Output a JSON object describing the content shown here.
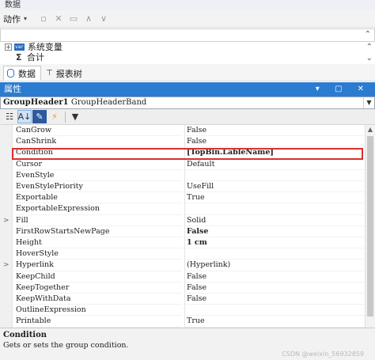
{
  "window": {
    "title": "数据"
  },
  "toolbar": {
    "actions_label": "动作"
  },
  "tree": {
    "items": [
      {
        "label": "系统变量",
        "icon": "var-icon"
      },
      {
        "label": "合计",
        "icon": "sigma-icon"
      }
    ]
  },
  "tabs": [
    {
      "label": "数据",
      "active": true
    },
    {
      "label": "报表树",
      "active": false
    }
  ],
  "properties_panel": {
    "title": "属性",
    "selected_object_name": "GroupHeader1",
    "selected_object_type": "GroupHeaderBand"
  },
  "properties": [
    {
      "name": "CanGrow",
      "value": "False",
      "expandable": false,
      "bold": false
    },
    {
      "name": "CanShrink",
      "value": "False",
      "expandable": false,
      "bold": false
    },
    {
      "name": "Condition",
      "value": "[TopBin.LableName]",
      "expandable": false,
      "bold": true,
      "highlighted": true
    },
    {
      "name": "Cursor",
      "value": "Default",
      "expandable": false,
      "bold": false
    },
    {
      "name": "EvenStyle",
      "value": "",
      "expandable": false,
      "bold": false
    },
    {
      "name": "EvenStylePriority",
      "value": "UseFill",
      "expandable": false,
      "bold": false
    },
    {
      "name": "Exportable",
      "value": "True",
      "expandable": false,
      "bold": false
    },
    {
      "name": "ExportableExpression",
      "value": "",
      "expandable": false,
      "bold": false
    },
    {
      "name": "Fill",
      "value": "Solid",
      "expandable": true,
      "bold": false
    },
    {
      "name": "FirstRowStartsNewPage",
      "value": "False",
      "expandable": false,
      "bold": true
    },
    {
      "name": "Height",
      "value": "1 cm",
      "expandable": false,
      "bold": true
    },
    {
      "name": "HoverStyle",
      "value": "",
      "expandable": false,
      "bold": false
    },
    {
      "name": "Hyperlink",
      "value": "(Hyperlink)",
      "expandable": true,
      "bold": false
    },
    {
      "name": "KeepChild",
      "value": "False",
      "expandable": false,
      "bold": false
    },
    {
      "name": "KeepTogether",
      "value": "False",
      "expandable": false,
      "bold": false
    },
    {
      "name": "KeepWithData",
      "value": "False",
      "expandable": false,
      "bold": false
    },
    {
      "name": "OutlineExpression",
      "value": "",
      "expandable": false,
      "bold": false
    },
    {
      "name": "Printable",
      "value": "True",
      "expandable": false,
      "bold": false
    }
  ],
  "description": {
    "title": "Condition",
    "text": "Gets or sets the group condition."
  },
  "watermark": "CSDN @weixin_56932859",
  "colors": {
    "accent": "#2b7bd1",
    "highlight": "#d9302c"
  }
}
